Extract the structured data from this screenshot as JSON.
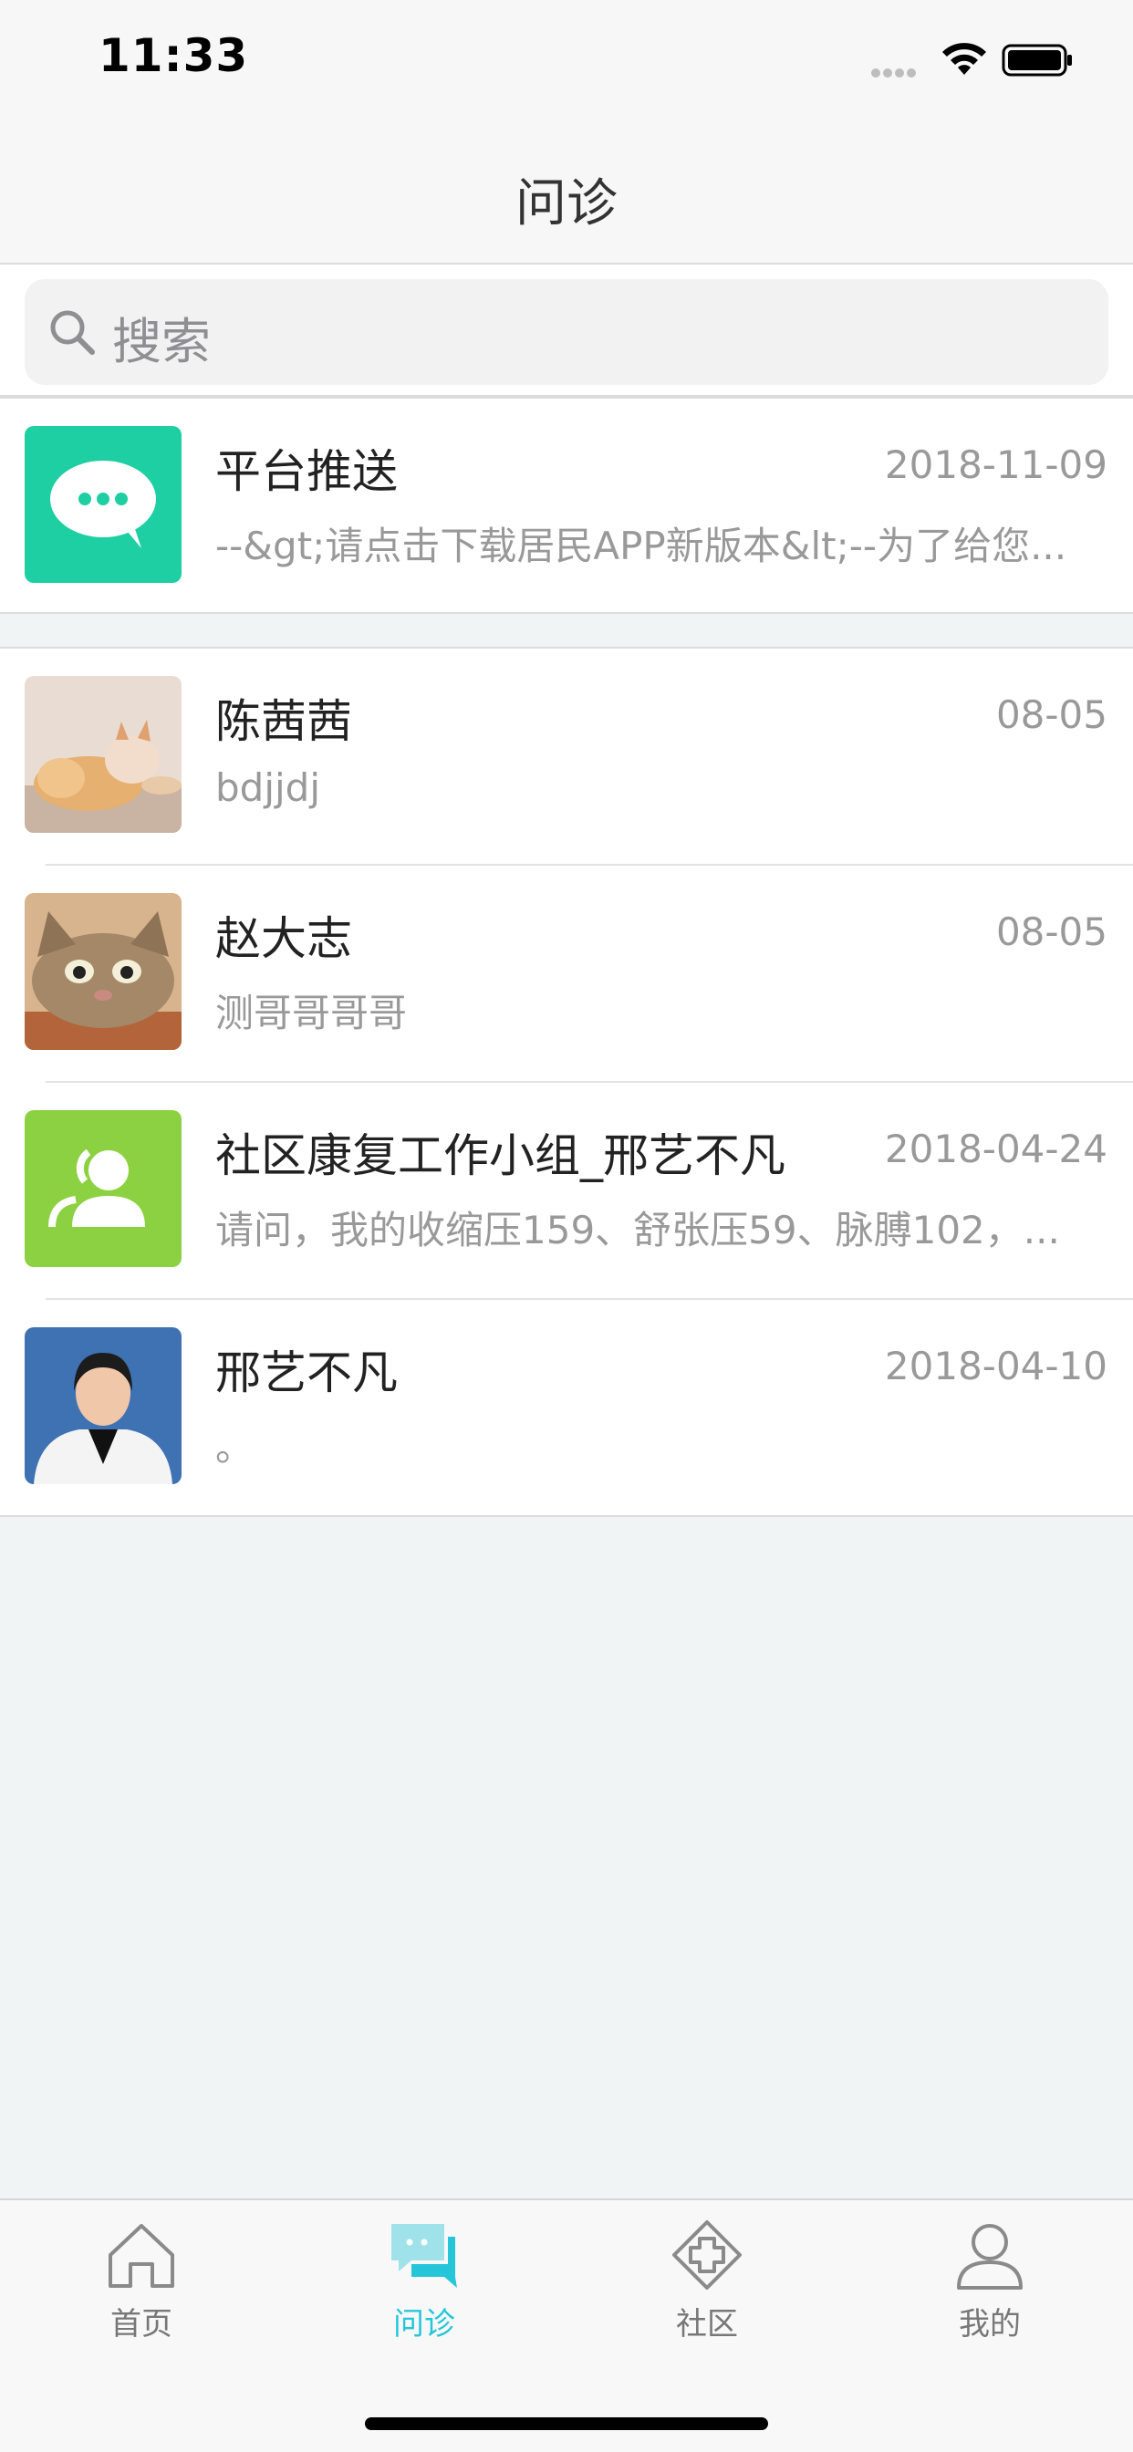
{
  "status_bar": {
    "time": "11:33"
  },
  "nav": {
    "title": "问诊"
  },
  "search": {
    "placeholder": "搜索"
  },
  "pinned": {
    "name": "平台推送",
    "date": "2018-11-09",
    "message": "--&gt;请点击下载居民APP新版本&lt;--为了给您..."
  },
  "chats": [
    {
      "name": "陈茜茜",
      "date": "08-05",
      "message": "bdjjdj",
      "avatar": "puppy-kitten-photo"
    },
    {
      "name": "赵大志",
      "date": "08-05",
      "message": "测哥哥哥哥",
      "avatar": "cat-photo"
    },
    {
      "name": "社区康复工作小组_邢艺不凡",
      "date": "2018-04-24",
      "message": "请问，我的收缩压159、舒张压59、脉膊102，...",
      "avatar": "group-icon"
    },
    {
      "name": "邢艺不凡",
      "date": "2018-04-10",
      "message": "。",
      "avatar": "doctor-photo"
    }
  ],
  "tabs": [
    {
      "label": "首页",
      "icon": "home-icon",
      "active": false
    },
    {
      "label": "问诊",
      "icon": "chat-icon",
      "active": true
    },
    {
      "label": "社区",
      "icon": "community-icon",
      "active": false
    },
    {
      "label": "我的",
      "icon": "profile-icon",
      "active": false
    }
  ],
  "colors": {
    "accent": "#26c6da",
    "pinned_avatar": "#1ecfa3",
    "group_avatar": "#8cd142"
  }
}
